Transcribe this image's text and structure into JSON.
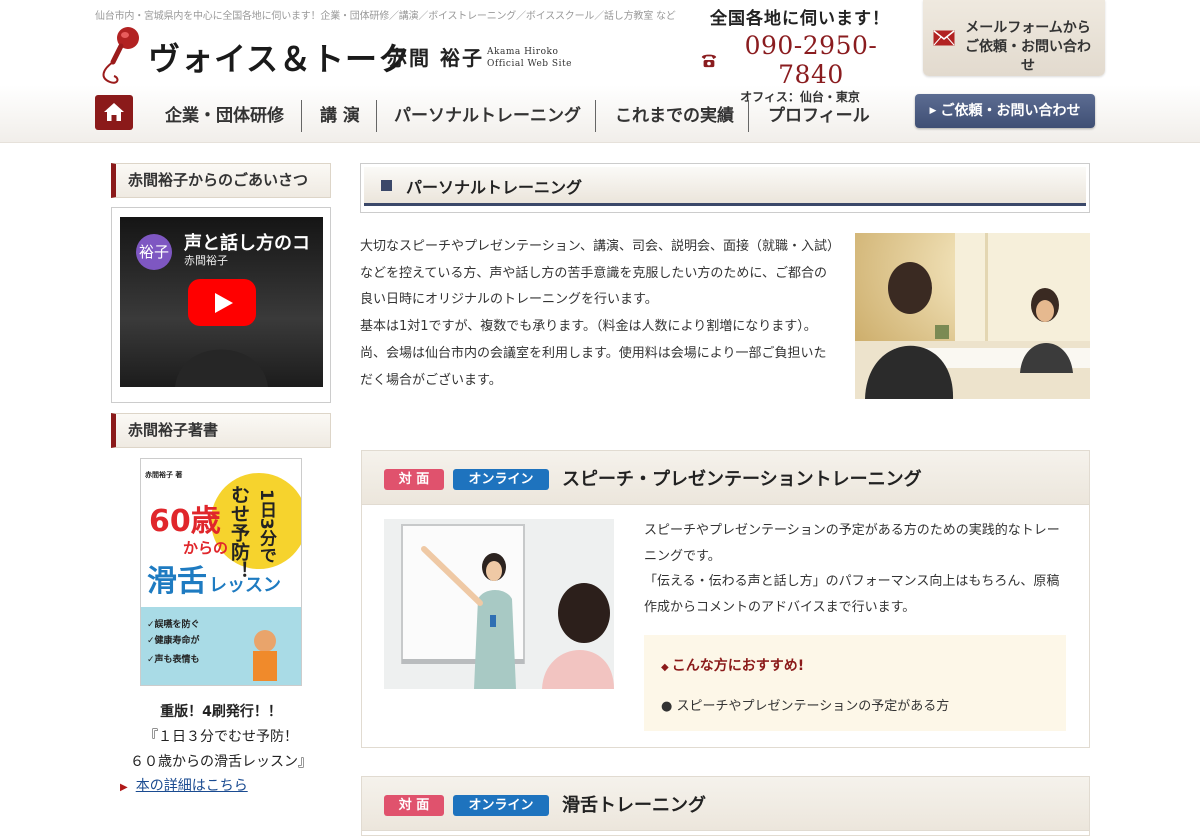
{
  "header": {
    "tagline": "仙台市内・宮城県内を中心に全国各地に伺います！企業・団体研修／講演／ボイストレーニング／ボイススクール／話し方教室 など",
    "brand": "ヴォイス＆トーク",
    "person": "赤間 裕子",
    "romaji_line1": "Akama Hiroko",
    "romaji_line2": "Official Web Site",
    "nationwide": "全国各地に伺います！",
    "phone": "090-2950-7840",
    "office": "オフィス：仙台・東京",
    "mail_line1": "メールフォームから",
    "mail_line2": "ご依頼・お問い合わせ"
  },
  "nav": {
    "items": [
      "企業・団体研修",
      "講 演",
      "パーソナルトレーニング",
      "これまでの実績",
      "プロフィール"
    ],
    "contact_label": "ご依頼・お問い合わせ"
  },
  "sidebar": {
    "greeting_head": "赤間裕子からのごあいさつ",
    "video": {
      "avatar_text": "裕子",
      "title": "声と話し方のコ",
      "channel": "赤間裕子"
    },
    "books_head": "赤間裕子著書",
    "book": {
      "author": "赤間裕子",
      "badge": "1日3分でむせ予防！",
      "age": "60歳",
      "kara": "からの",
      "title": "滑舌レッスン"
    },
    "book_caption": [
      "重版！4刷発行！！",
      "『１日３分でむせ予防！",
      "６０歳からの滑舌レッスン』"
    ],
    "book_link": "本の詳細はこちら"
  },
  "main": {
    "page_title": "パーソナルトレーニング",
    "intro": [
      "大切なスピーチやプレゼンテーション、講演、司会、説明会、面接（就職・入試）などを控えている方、声や話し方の苦手意識を克服したい方のために、ご都合の良い日時にオリジナルのトレーニングを行います。",
      "基本は1対1ですが、複数でも承ります。（料金は人数により割増になります）。",
      "尚、会場は仙台市内の会議室を利用します。使用料は会場により一部ご負担いただく場合がございます。"
    ],
    "cards": [
      {
        "badge_face": "対 面",
        "badge_online": "オンライン",
        "title": "スピーチ・プレゼンテーショントレーニング",
        "desc": [
          "スピーチやプレゼンテーションの予定がある方のための実践的なトレーニングです。",
          "「伝える・伝わる声と話し方」のパフォーマンス向上はもちろん、原稿作成からコメントのアドバイスまで行います。"
        ],
        "rec_title": "こんな方におすすめ!",
        "rec_item": "スピーチやプレゼンテーションの予定がある方"
      },
      {
        "badge_face": "対 面",
        "badge_online": "オンライン",
        "title": "滑舌トレーニング"
      }
    ]
  }
}
